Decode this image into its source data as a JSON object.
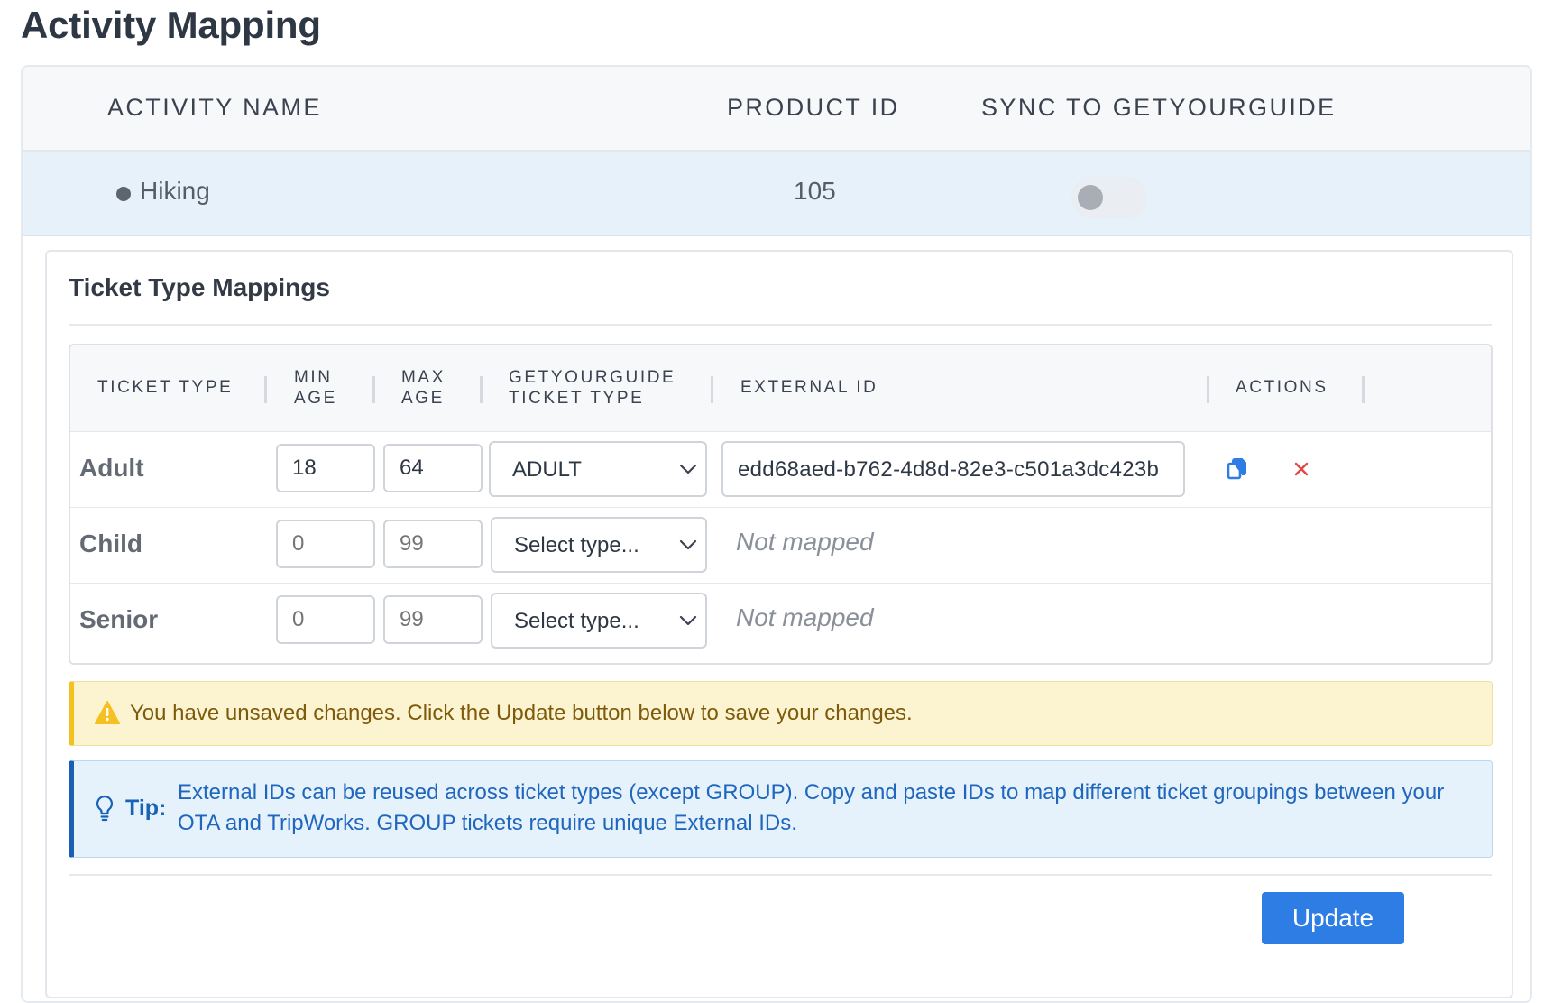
{
  "page": {
    "title": "Activity Mapping"
  },
  "activity_table": {
    "headers": {
      "activity_name": "ACTIVITY NAME",
      "product_id": "PRODUCT ID",
      "sync": "SYNC TO GETYOURGUIDE"
    },
    "row": {
      "name": "Hiking",
      "product_id": "105",
      "sync_enabled": false
    }
  },
  "ticket_mappings": {
    "title": "Ticket Type Mappings",
    "headers": {
      "ticket_type": "TICKET TYPE",
      "min_age_1": "MIN",
      "min_age_2": "AGE",
      "max_age_1": "MAX",
      "max_age_2": "AGE",
      "gyg_type_1": "GETYOURGUIDE",
      "gyg_type_2": "TICKET TYPE",
      "external_id": "EXTERNAL ID",
      "actions": "ACTIONS"
    },
    "rows": [
      {
        "label": "Adult",
        "min_age": "18",
        "max_age": "64",
        "gyg_type": "ADULT",
        "external_id": "edd68aed-b762-4d8d-82e3-c501a3dc423b"
      },
      {
        "label": "Child",
        "min_age_placeholder": "0",
        "max_age_placeholder": "99",
        "gyg_type": "Select type...",
        "external_id_status": "Not mapped"
      },
      {
        "label": "Senior",
        "min_age_placeholder": "0",
        "max_age_placeholder": "99",
        "gyg_type": "Select type...",
        "external_id_status": "Not mapped"
      }
    ]
  },
  "warning": {
    "text": "You have unsaved changes. Click the Update button below to save your changes."
  },
  "tip": {
    "label": "Tip:",
    "text": "External IDs can be reused across ticket types (except GROUP). Copy and paste IDs to map different ticket groupings between your OTA and TripWorks. GROUP tickets require unique External IDs."
  },
  "footer": {
    "update_label": "Update"
  },
  "colors": {
    "primary": "#2d7de4",
    "delete": "#e04545",
    "warning_accent": "#f5c122",
    "tip_accent": "#1a5fb4"
  }
}
